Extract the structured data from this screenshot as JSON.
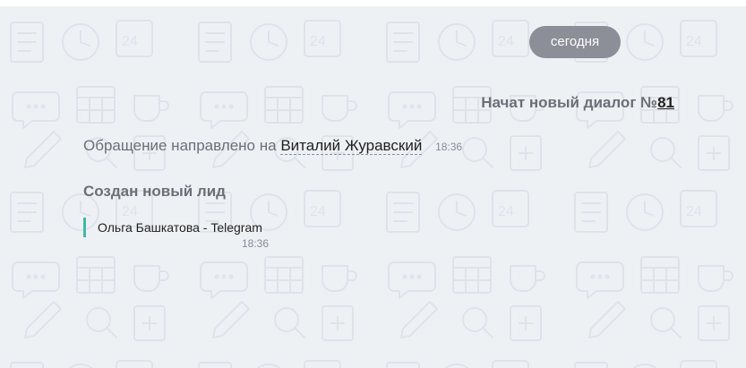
{
  "date_separator": "сегодня",
  "system_event": {
    "prefix": "Начат новый диалог №",
    "dialog_number": "81"
  },
  "routing_event": {
    "prefix": "Обращение направлено на",
    "agent_name": "Виталий Журавский",
    "time": "18:36"
  },
  "lead_event": {
    "title": "Создан новый лид",
    "lead_label": "Ольга Башкатова - Telegram",
    "time": "18:36"
  },
  "colors": {
    "background": "#eef1f4",
    "date_pill": "#8c8e98",
    "lead_accent": "#3fb8a8"
  }
}
